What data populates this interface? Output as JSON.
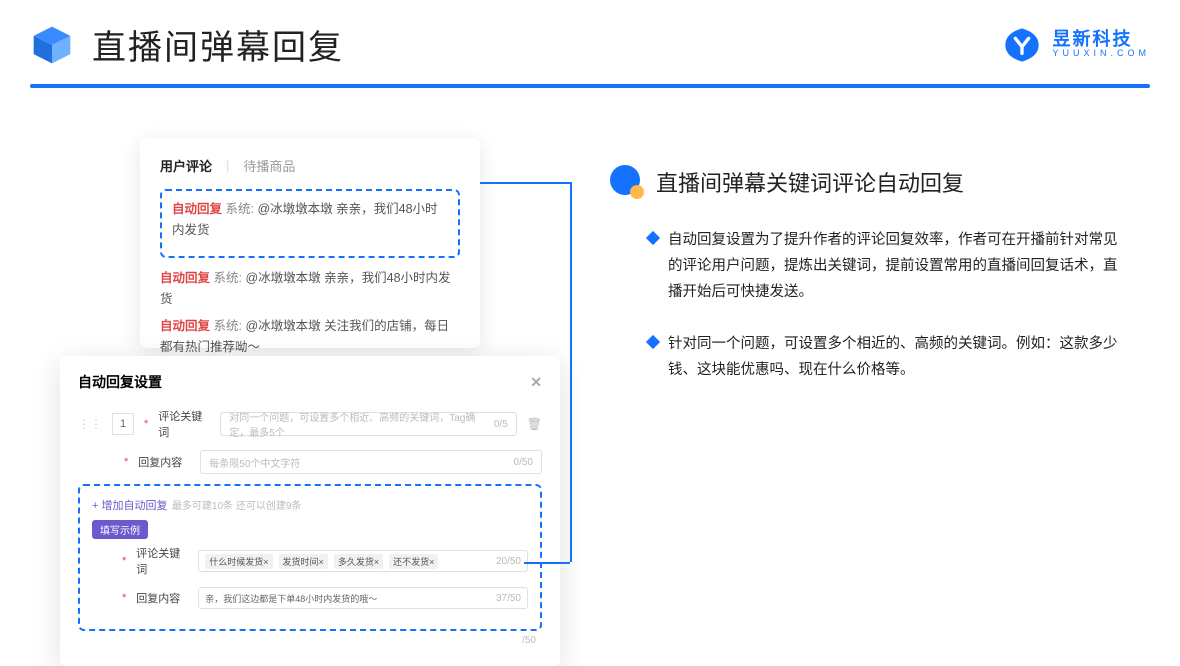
{
  "header": {
    "title": "直播间弹幕回复",
    "brand_name": "昱新科技",
    "brand_sub": "YUUXIN.COM"
  },
  "comments": {
    "tab_active": "用户评论",
    "tab_inactive": "待播商品",
    "auto_tag": "自动回复",
    "sys_tag": "系统:",
    "msg1_body": "@冰墩墩本墩 亲亲，我们48小时内发货",
    "msg2_body": "@冰墩墩本墩 亲亲，我们48小时内发货",
    "msg3_body": "@冰墩墩本墩 关注我们的店铺，每日都有热门推荐呦～"
  },
  "settings": {
    "title": "自动回复设置",
    "index": "1",
    "label_keyword": "评论关键词",
    "ph_keyword": "对同一个问题，可设置多个相近、高频的关键词，Tag确定，最多5个",
    "count_keyword": "0/5",
    "label_reply": "回复内容",
    "ph_reply": "每条限50个中文字符",
    "count_reply": "0/50",
    "add_link": "+ 增加自动回复",
    "add_sub": "最多可建10条 还可以创建9条",
    "example_chip": "填写示例",
    "ex_label_keyword": "评论关键词",
    "ex_tags": [
      "什么时候发货×",
      "发货时间×",
      "多久发货×",
      "还不发货×"
    ],
    "ex_count_keyword": "20/50",
    "ex_label_reply": "回复内容",
    "ex_reply_text": "亲，我们这边都是下单48小时内发货的哦～",
    "ex_count_reply": "37/50",
    "bottom_count": "/50"
  },
  "right": {
    "sec_title": "直播间弹幕关键词评论自动回复",
    "bullet1": "自动回复设置为了提升作者的评论回复效率，作者可在开播前针对常见的评论用户问题，提炼出关键词，提前设置常用的直播间回复话术，直播开始后可快捷发送。",
    "bullet2": "针对同一个问题，可设置多个相近的、高频的关键词。例如：这款多少钱、这块能优惠吗、现在什么价格等。"
  }
}
